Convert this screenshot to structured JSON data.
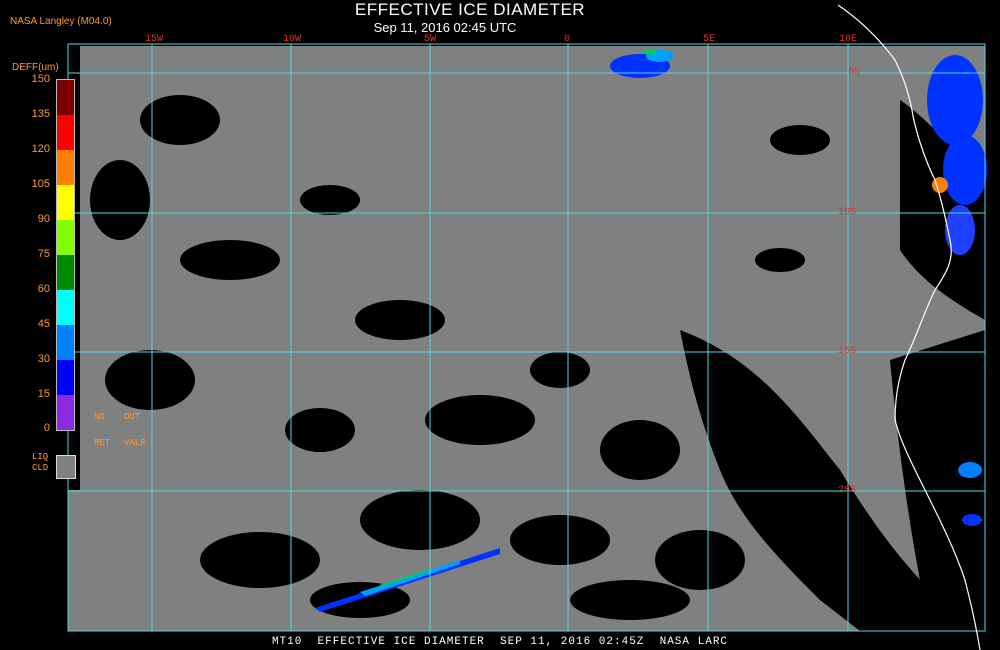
{
  "header": {
    "title": "EFFECTIVE ICE DIAMETER",
    "subtitle": "Sep 11, 2016 02:45 UTC",
    "credit": "NASA Langley (M04.0)"
  },
  "grid": {
    "longitude_labels": [
      "15W",
      "10W",
      "5W",
      "0",
      "5E",
      "10E"
    ],
    "latitude_labels": [
      "5S",
      "10S",
      "15S",
      "20S"
    ]
  },
  "legend": {
    "title": "DEFF(um)",
    "ticks": [
      "150",
      "135",
      "120",
      "105",
      "90",
      "75",
      "60",
      "45",
      "30",
      "15",
      "0"
    ],
    "colors": [
      "#7a0000",
      "#ff0000",
      "#ff7f00",
      "#ffff00",
      "#80ff00",
      "#008800",
      "#00ffff",
      "#0080ff",
      "#0000ff",
      "#8a2be2"
    ],
    "no_ret": "NO\nRET",
    "out_valr": "OUT\nVALR",
    "liq_cld": "LIQ\nCLD",
    "liq_color": "#808080"
  },
  "colors": {
    "liquid_cloud": "#808080",
    "clear": "#000000",
    "grid": "#4fd7e0",
    "coast": "#ffffff",
    "labels": "#e03030"
  },
  "footer": {
    "text": "MT10  EFFECTIVE ICE DIAMETER  SEP 11, 2016 02:45Z  NASA LARC"
  }
}
